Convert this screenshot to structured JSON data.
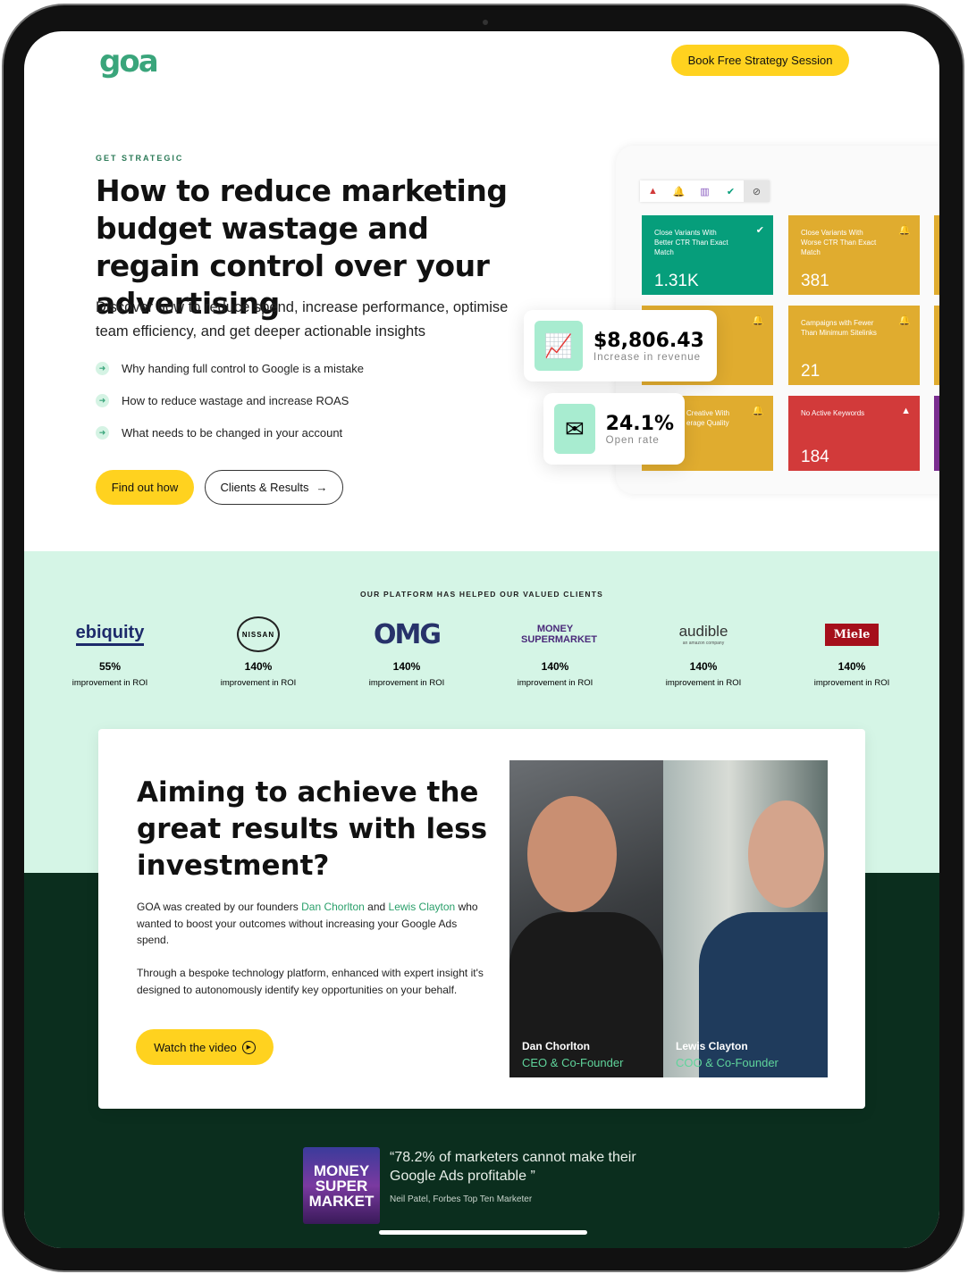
{
  "header": {
    "logo": "goa",
    "cta": "Book Free Strategy Session"
  },
  "hero": {
    "eyebrow": "GET STRATEGIC",
    "title": "How to reduce marketing budget wastage and regain control over your advertising",
    "lead": "Discover how to reduce spend, increase performance, optimise team efficiency, and get deeper actionable insights",
    "bullets": [
      "Why handing full control to Google is a mistake",
      "How to reduce wastage and increase ROAS",
      "What needs to be changed in your account"
    ],
    "primary_btn": "Find out how",
    "secondary_btn": "Clients & Results"
  },
  "dashboard": {
    "tiles": [
      {
        "label": "Close Variants With Better CTR Than Exact Match",
        "value": "1.31K",
        "color": "#069e7b",
        "icon": "check-icon"
      },
      {
        "label": "Close Variants With Worse CTR Than Exact Match",
        "value": "381",
        "color": "#e0ac2f",
        "icon": "bell-icon"
      },
      {
        "label": "Campaigns with Fewer Than Minimum Sitelinks",
        "value": "21",
        "color": "#e0ac2f",
        "icon": "bell-icon"
      },
      {
        "label": "Creative With erage Quality",
        "value": "",
        "color": "#e0ac2f",
        "icon": "bell-icon"
      },
      {
        "label": "No Active Keywords",
        "value": "184",
        "color": "#d23a3a",
        "icon": "warning-icon"
      }
    ],
    "revenue": {
      "value": "$8,806.43",
      "label": "Increase in revenue"
    },
    "open_rate": {
      "value": "24.1%",
      "label": "Open rate"
    }
  },
  "clients": {
    "title": "OUR PLATFORM HAS HELPED OUR VALUED CLIENTS",
    "items": [
      {
        "name": "ebiquity",
        "pct": "55%",
        "sub": "improvement in ROI"
      },
      {
        "name": "NISSAN",
        "pct": "140%",
        "sub": "improvement in ROI"
      },
      {
        "name": "OMG",
        "pct": "140%",
        "sub": "improvement in ROI"
      },
      {
        "name": "MONEY SUPERMARKET",
        "pct": "140%",
        "sub": "improvement in ROI"
      },
      {
        "name": "audible",
        "tagline": "an amazon company",
        "pct": "140%",
        "sub": "improvement in ROI"
      },
      {
        "name": "Miele",
        "pct": "140%",
        "sub": "improvement in ROI"
      }
    ]
  },
  "about": {
    "title": "Aiming to achieve the great results with less investment?",
    "p1_a": "GOA was created by our founders ",
    "founder1": "Dan Chorlton",
    "and": " and ",
    "founder2": "Lewis Clayton",
    "p1_b": " who wanted to boost your outcomes without increasing your Google Ads spend.",
    "p2": "Through a bespoke technology platform, enhanced with expert insight it's designed to autonomously identify key opportunities on your behalf.",
    "video_btn": "Watch the video",
    "people": [
      {
        "name": "Dan Chorlton",
        "role": "CEO & Co-Founder"
      },
      {
        "name": "Lewis Clayton",
        "role": "COO & Co-Founder"
      }
    ]
  },
  "quote": {
    "logo": "MONEY SUPER MARKET",
    "text": "“78.2% of marketers cannot make their Google Ads profitable ”",
    "by": "Neil Patel, Forbes Top Ten Marketer"
  }
}
